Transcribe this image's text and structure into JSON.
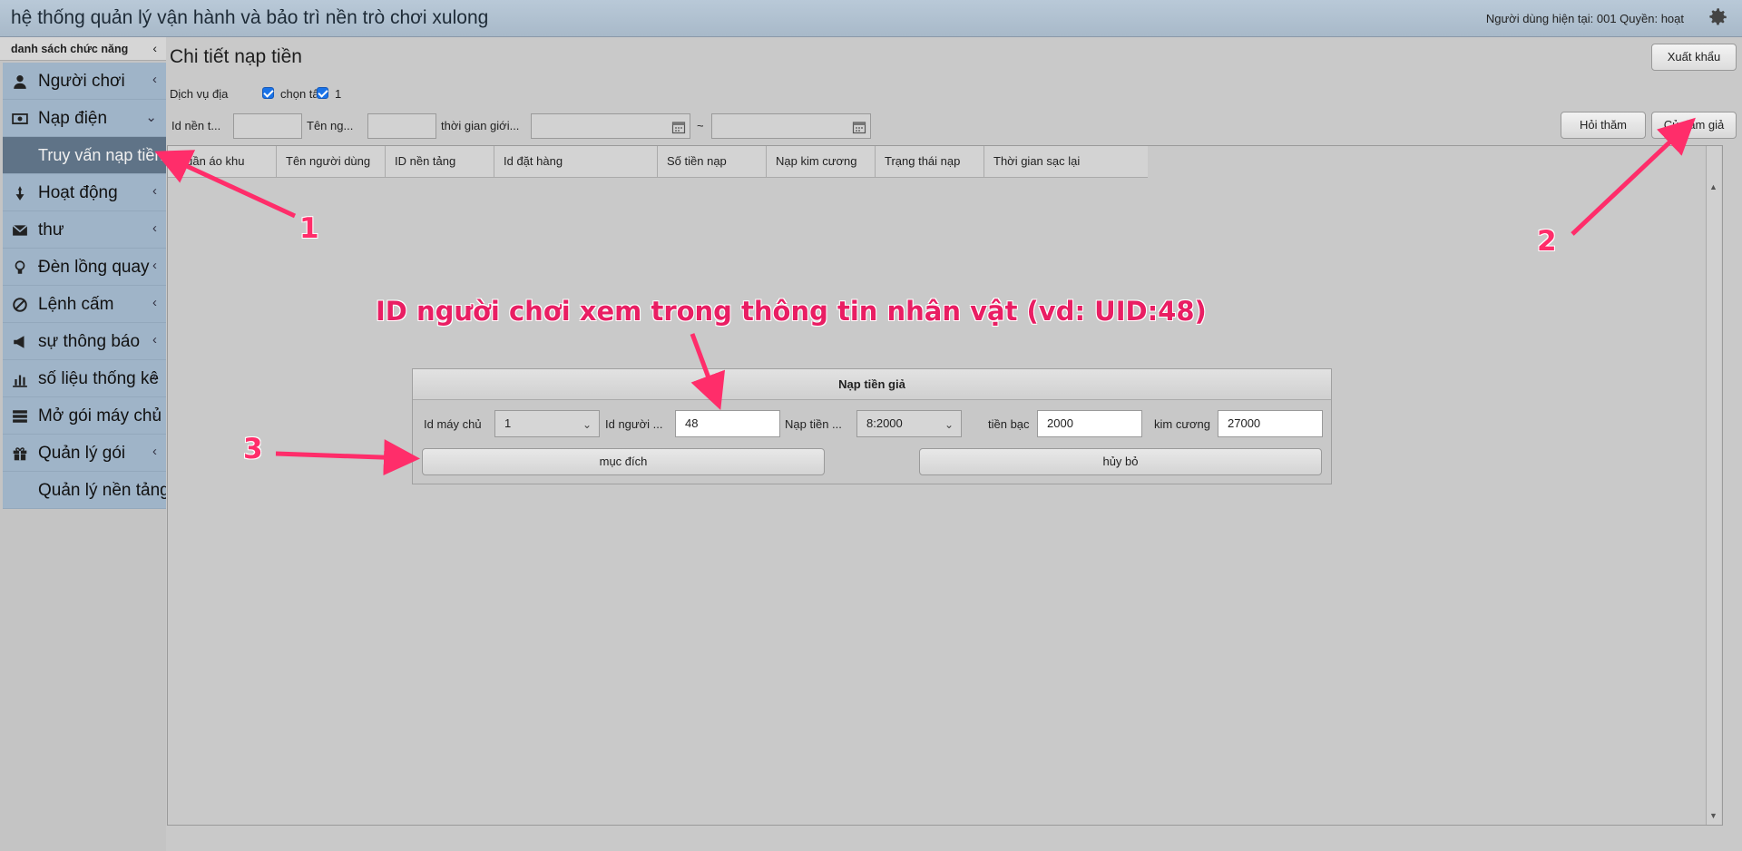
{
  "header": {
    "title": "hệ thống quản lý vận hành và bảo trì nền trò chơi xulong",
    "user_info": "Người dùng hiện tại: 001 Quyền: hoạt",
    "settings_icon": "gear-icon"
  },
  "sidebar": {
    "title": "danh sách chức năng",
    "items": [
      {
        "label": "Người chơi",
        "icon": "user-icon",
        "chevron": "‹"
      },
      {
        "label": "Nạp điện",
        "icon": "money-icon",
        "chevron": "⌄"
      },
      {
        "label": "Truy vấn nạp tiền",
        "sub": true
      },
      {
        "label": "Hoạt động",
        "icon": "activity-icon",
        "chevron": "‹"
      },
      {
        "label": "thư",
        "icon": "mail-icon",
        "chevron": "‹"
      },
      {
        "label": "Đèn lồng quay",
        "icon": "lightbulb-icon",
        "chevron": "‹"
      },
      {
        "label": "Lệnh cấm",
        "icon": "ban-icon",
        "chevron": "‹"
      },
      {
        "label": "sự thông báo",
        "icon": "megaphone-icon",
        "chevron": "‹"
      },
      {
        "label": "số liệu thống kê",
        "icon": "chart-icon",
        "chevron": "‹"
      },
      {
        "label": "Mở gói máy chủ",
        "icon": "server-icon",
        "chevron": "‹"
      },
      {
        "label": "Quản lý gói",
        "icon": "gift-icon",
        "chevron": "‹"
      },
      {
        "label": "Quản lý nền tảng",
        "plain": true
      }
    ]
  },
  "main": {
    "page_title": "Chi tiết nạp tiền",
    "export_label": "Xuất khẩu",
    "service_label": "Dịch vụ địa",
    "checkbox1_label": "chọn tấ",
    "checkbox2_label": "1",
    "filters": {
      "platform_id_label": "Id nền t...",
      "username_label": "Tên ng...",
      "time_label": "thời gian giới...",
      "range_sep": "~"
    },
    "query_label": "Hỏi thăm",
    "fake_label": "Củ đấm giả",
    "columns": [
      "Quần áo khu",
      "Tên người dùng",
      "ID nền tảng",
      "Id đặt hàng",
      "Số tiền nạp",
      "Nạp kim cương",
      "Trạng thái nạp",
      "Thời gian sạc lại"
    ]
  },
  "dialog": {
    "title": "Nạp tiền giả",
    "server_id_label": "Id máy chủ",
    "server_id_value": "1",
    "player_id_label": "Id người ...",
    "player_id_value": "48",
    "recharge_label": "Nạp tiền ...",
    "recharge_value": "8:2000",
    "silver_label": "tiền bạc",
    "silver_value": "2000",
    "diamond_label": "kim cương",
    "diamond_value": "27000",
    "confirm_label": "mục đích",
    "cancel_label": "hủy bỏ"
  },
  "annotations": {
    "num1": "1",
    "num2": "2",
    "num3": "3",
    "note": "ID người chơi xem trong thông tin nhân vật (vd: UID:48)",
    "color": "#ff2d6a"
  }
}
